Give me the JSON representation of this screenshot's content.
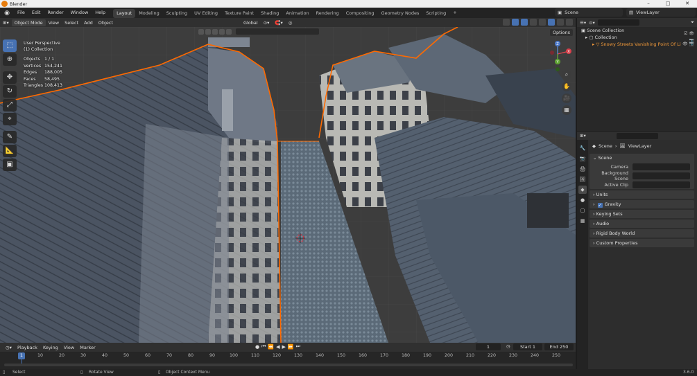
{
  "window": {
    "title": "Blender",
    "controls": [
      "–",
      "□",
      "✕"
    ]
  },
  "menubar": {
    "menus": [
      "File",
      "Edit",
      "Render",
      "Window",
      "Help"
    ],
    "workspaces": [
      "Layout",
      "Modeling",
      "Sculpting",
      "UV Editing",
      "Texture Paint",
      "Shading",
      "Animation",
      "Rendering",
      "Compositing",
      "Geometry Nodes",
      "Scripting"
    ],
    "active_workspace": "Layout",
    "add_tab": "+",
    "scene": "Scene",
    "view_layer": "ViewLayer"
  },
  "viewport_header": {
    "mode": "Object Mode",
    "menus": [
      "View",
      "Select",
      "Add",
      "Object"
    ],
    "transform_orientation": "Global",
    "options": "Options"
  },
  "viewport": {
    "perspective": "User Perspective",
    "collection": "(1) Collection",
    "stats": [
      {
        "label": "Objects",
        "value": "1 / 1"
      },
      {
        "label": "Vertices",
        "value": "154,241"
      },
      {
        "label": "Edges",
        "value": "188,005"
      },
      {
        "label": "Faces",
        "value": "58,495"
      },
      {
        "label": "Triangles",
        "value": "108,413"
      }
    ],
    "gizmo": {
      "x": "X",
      "y": "Y",
      "z": "Z"
    }
  },
  "outliner": {
    "scene_collection": "Scene Collection",
    "collection": "Collection",
    "object": "Snowy Streets Vanishing Point Of Li"
  },
  "properties": {
    "breadcrumb_scene": "Scene",
    "breadcrumb_layer": "ViewLayer",
    "panel_scene": "Scene",
    "fields": [
      {
        "label": "Camera"
      },
      {
        "label": "Background Scene"
      },
      {
        "label": "Active Clip"
      }
    ],
    "subpanels": [
      "Units",
      "Gravity",
      "Keying Sets",
      "Audio",
      "Rigid Body World",
      "Custom Properties"
    ]
  },
  "timeline": {
    "menus": [
      "Playback",
      "Keying",
      "View",
      "Marker"
    ],
    "current_frame": "1",
    "start_label": "Start",
    "start": "1",
    "end_label": "End",
    "end": "250",
    "ticks": [
      "10",
      "20",
      "30",
      "40",
      "50",
      "60",
      "70",
      "80",
      "90",
      "100",
      "110",
      "120",
      "130",
      "140",
      "150",
      "160",
      "170",
      "180",
      "190",
      "200",
      "210",
      "220",
      "230",
      "240",
      "250"
    ],
    "playhead": "1"
  },
  "statusbar": {
    "select": "Select",
    "rotate": "Rotate View",
    "context": "Object Context Menu",
    "version": "3.6.0"
  },
  "colors": {
    "accent": "#4772b3",
    "selection_outline": "#ff6a00",
    "object_name": "#f49b3a"
  }
}
